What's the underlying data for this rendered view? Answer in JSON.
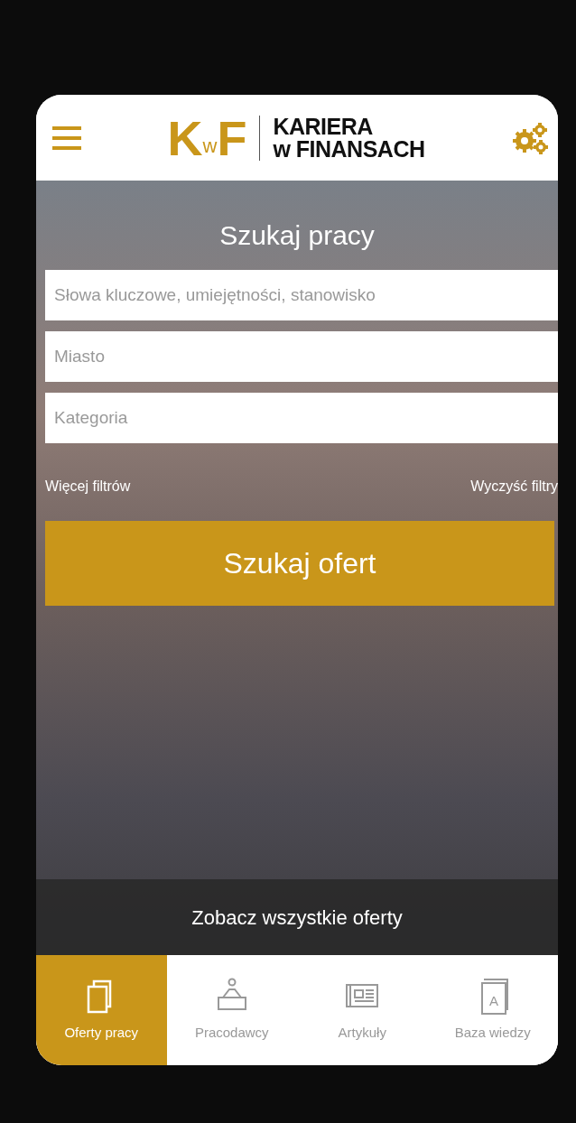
{
  "header": {
    "logo_mark": "K$_{w}$F",
    "logo_line1": "KARIERA",
    "logo_line2": "w FINANSACH"
  },
  "search": {
    "title": "Szukaj pracy",
    "fields": [
      {
        "placeholder": "Słowa kluczowe, umiejętności, stanowisko"
      },
      {
        "placeholder": "Miasto"
      },
      {
        "placeholder": "Kategoria"
      }
    ],
    "more_filters": "Więcej filtrów",
    "clear_filters": "Wyczyść filtry",
    "submit": "Szukaj ofert"
  },
  "all_offers": "Zobacz wszystkie oferty",
  "tabs": [
    {
      "kind": "offers",
      "label": "Oferty pracy",
      "selected": true
    },
    {
      "kind": "employers",
      "label": "Pracodawcy",
      "selected": false
    },
    {
      "kind": "articles",
      "label": "Artykuły",
      "selected": false
    },
    {
      "kind": "knowledge",
      "label": "Baza wiedzy",
      "selected": false,
      "icon_letter": "A"
    }
  ]
}
